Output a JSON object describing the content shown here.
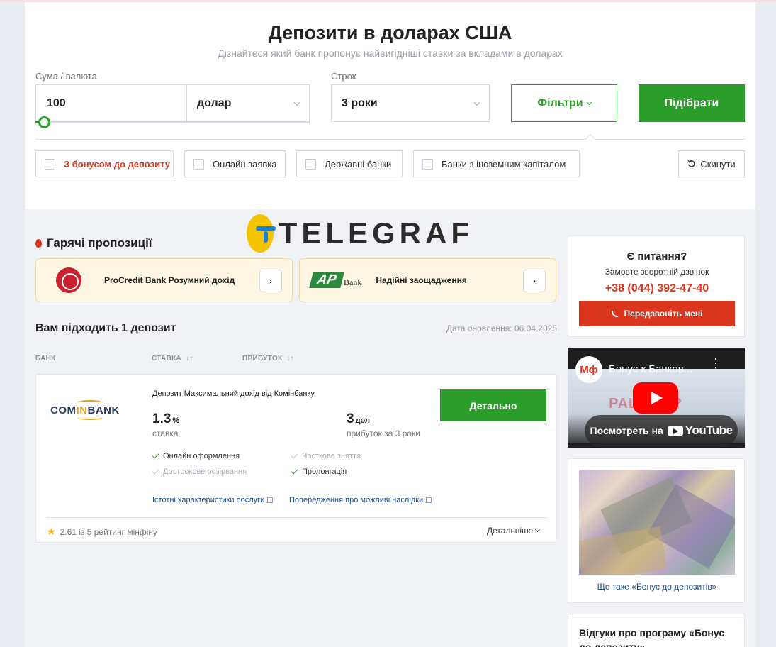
{
  "header": {
    "title": "Депозити в доларах США",
    "subtitle": "Дізнайтеся який банк пропонує найвигідніші ставки за вкладами в доларах"
  },
  "form": {
    "amount_label": "Сума / валюта",
    "amount_value": "100",
    "currency_value": "долар",
    "term_label": "Строк",
    "term_value": "3 роки",
    "filters_label": "Фільтри",
    "submit_label": "Підібрати"
  },
  "chips": {
    "bonus": "З бонусом до депозиту",
    "online": "Онлайн заявка",
    "state": "Державні банки",
    "foreign": "Банки з іноземним капіталом",
    "reset": "Скинути"
  },
  "watermark": {
    "text": "TELEGRAF"
  },
  "hot": {
    "title": "Гарячі пропозиції",
    "offers": [
      {
        "name": "ProCredit Bank Розумний дохід"
      },
      {
        "name": "Надійні заощадження",
        "logo_text": "AP",
        "logo_sub": "Bank"
      }
    ]
  },
  "results": {
    "title": "Вам підходить 1 депозит",
    "updated": "Дата оновлення: 06.04.2025",
    "columns": {
      "bank": "БАНК",
      "rate": "СТАВКА",
      "profit": "ПРИБУТОК"
    }
  },
  "deposit": {
    "bank_logo": {
      "part1": "COM",
      "part2": "IN",
      "part3": "BANK"
    },
    "name": "Депозит Максимальний дохід від Комінбанку",
    "rate_value": "1.3",
    "rate_unit": "%",
    "rate_label": "ставка",
    "profit_value": "3",
    "profit_unit": "дол",
    "profit_label": "прибуток за 3 роки",
    "detail_button": "Детально",
    "features": [
      {
        "label": "Онлайн оформлення",
        "enabled": true
      },
      {
        "label": "Часткове зняття",
        "enabled": false
      },
      {
        "label": "Дострокове розірвання",
        "enabled": false
      },
      {
        "label": "Пролонгація",
        "enabled": true
      }
    ],
    "links": {
      "essential": "Істотні характеристики послуги",
      "warnings": "Попередження про можливі наслідки"
    },
    "rating": "2.61 із 5 рейтинг мінфіну",
    "more": "Детальніше"
  },
  "sidebar": {
    "question": {
      "title": "Є питання?",
      "subtitle": "Замовте зворотній дзвінок",
      "phone": "+38 (044) 392-47-40",
      "button": "Передзвоніть мені"
    },
    "video": {
      "channel": "Мф",
      "title": "Бонус к Банков...",
      "overlay": "РАЦ...ЕТ?",
      "watch_label": "Посмотреть на",
      "youtube": "YouTube"
    },
    "bonus_caption": "Що таке «Бонус до депозитів»",
    "reviews_title": "Відгуки про програму «Бонус до депозиту»"
  },
  "colors": {
    "brand_green": "#2a9d2a",
    "accent_red": "#d9361d",
    "link_blue": "#1d4f91"
  }
}
